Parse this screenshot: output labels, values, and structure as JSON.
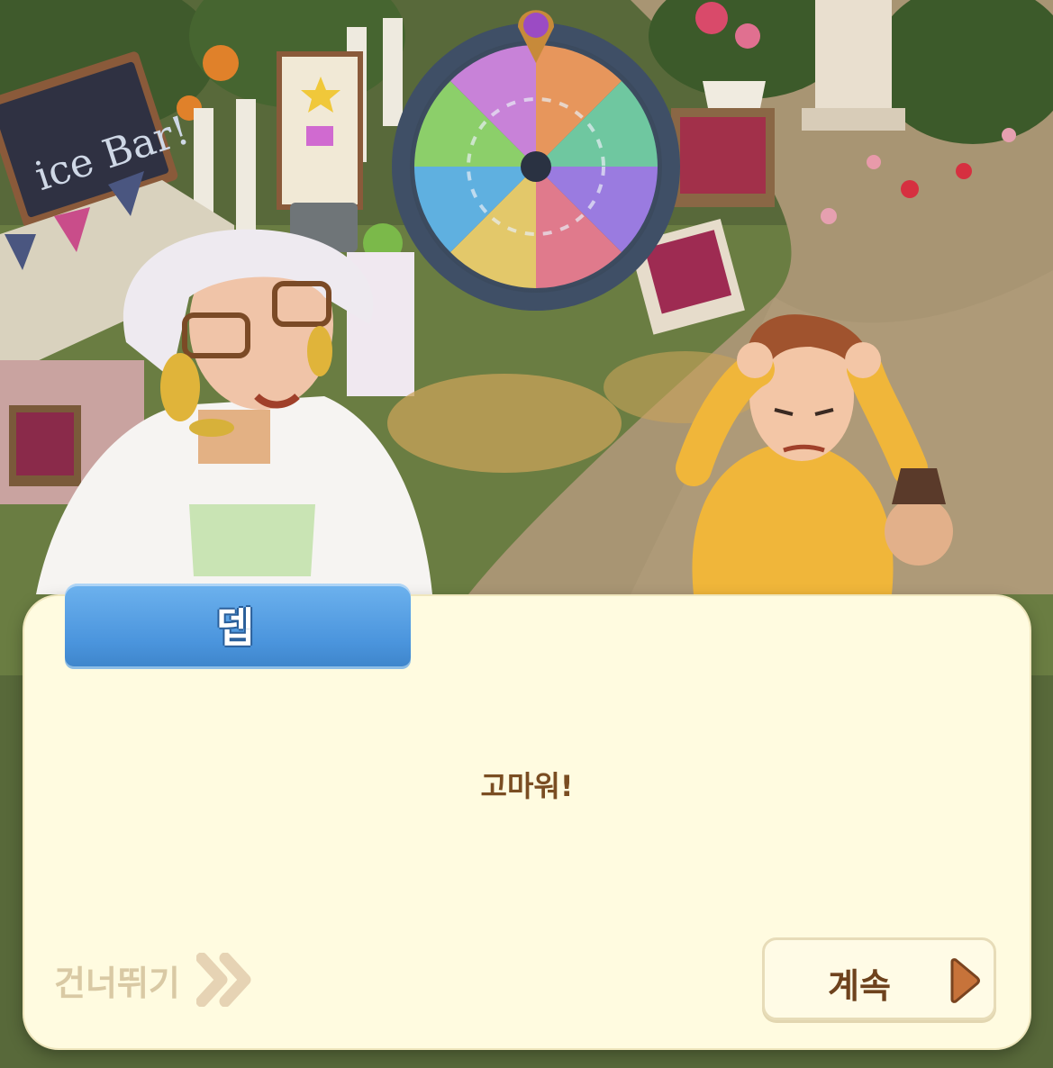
{
  "dialog": {
    "speaker_name": "뎁",
    "message": "고마워!",
    "skip_label": "건너뛰기",
    "continue_label": "계속"
  },
  "scene": {
    "sign_text": "ice Bar!"
  },
  "colors": {
    "panel": "#fffbe0",
    "name_tab": "#4b95dd",
    "message_text": "#7a4d22",
    "skip_text": "#d9c9a4",
    "continue_arrow": "#c7733a"
  },
  "icons": {
    "skip": "double-chevron-right-icon",
    "continue": "play-arrow-icon"
  }
}
